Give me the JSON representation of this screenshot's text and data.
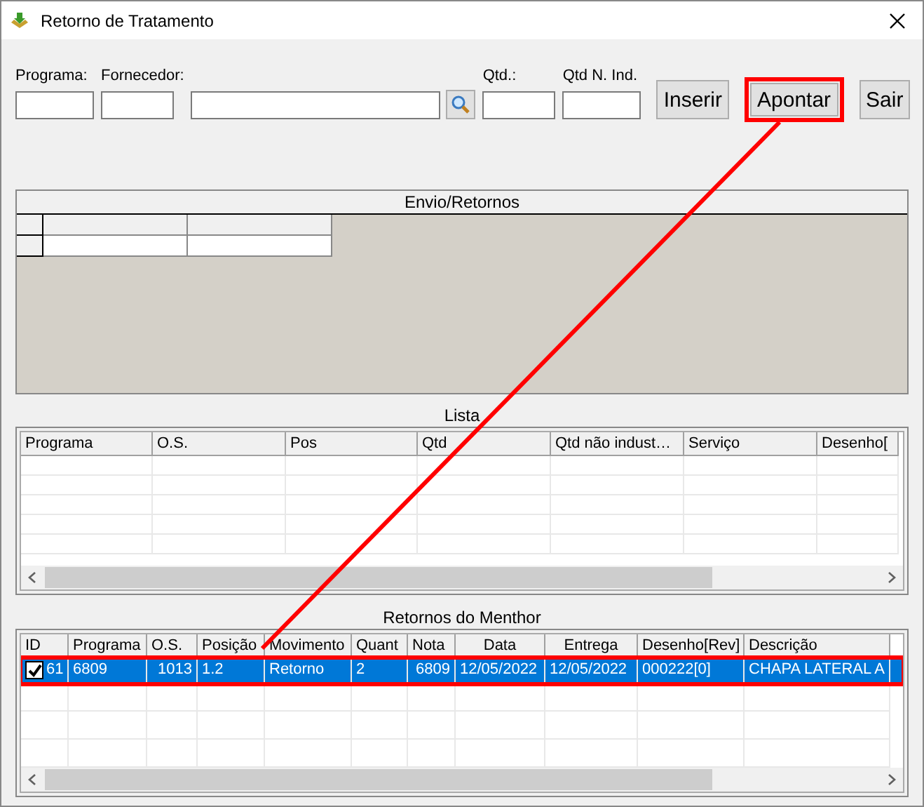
{
  "window": {
    "title": "Retorno de Tratamento"
  },
  "fields": [
    {
      "kind": "input",
      "label": "Programa:"
    },
    {
      "kind": "input",
      "label": "Fornecedor:"
    },
    {
      "kind": "input"
    },
    {
      "kind": "search"
    },
    {
      "kind": "input",
      "label": "Qtd.:"
    },
    {
      "kind": "input",
      "label": "Qtd N. Ind."
    }
  ],
  "buttons": [
    {
      "label": "Inserir",
      "highlighted": false
    },
    {
      "label": "Apontar",
      "highlighted": true
    },
    {
      "label": "Sair",
      "highlighted": false
    }
  ],
  "envio": {
    "title": "Envio/Retornos"
  },
  "lista": {
    "title": "Lista",
    "columns": [
      "Programa",
      "O.S.",
      "Pos",
      "Qtd",
      "Qtd não indust…",
      "Serviço",
      "Desenho["
    ]
  },
  "retornos": {
    "title": "Retornos do Menthor",
    "columns": [
      "ID",
      "Programa",
      "O.S.",
      "Posição",
      "Movimento",
      "Quant",
      "Nota",
      "Data",
      "Entrega",
      "Desenho[Rev]",
      "Descrição"
    ],
    "rows": [
      {
        "checked": true,
        "selected": true,
        "highlighted": true,
        "cells": [
          "61",
          "6809",
          "1013",
          "1.2",
          "Retorno",
          "2",
          "6809",
          "12/05/2022",
          "12/05/2022",
          "000222[0]",
          "CHAPA LATERAL A"
        ]
      }
    ]
  }
}
